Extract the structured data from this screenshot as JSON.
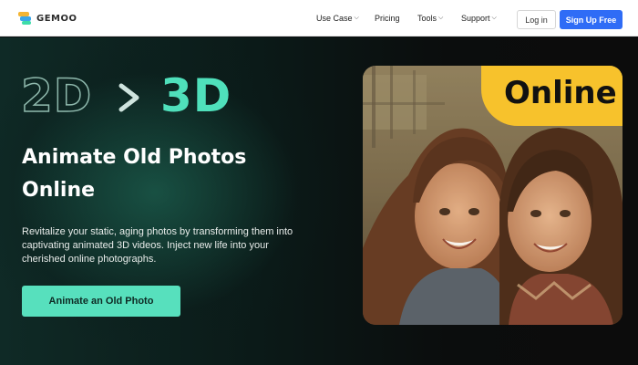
{
  "header": {
    "logo_text": "GEMOO",
    "nav": [
      {
        "label": "Use Case",
        "dropdown": true
      },
      {
        "label": "Pricing",
        "dropdown": false
      },
      {
        "label": "Tools",
        "dropdown": true
      },
      {
        "label": "Support",
        "dropdown": true
      }
    ],
    "login_label": "Log in",
    "signup_label": "Sign Up Free",
    "signup_color": "#2f6cf6"
  },
  "hero": {
    "from_label": "2D",
    "to_label": "3D",
    "title_line1": "Animate Old Photos",
    "title_line2": "Online",
    "description": "Revitalize your static, aging photos by transforming them into captivating animated 3D videos. Inject new life into your cherished online photographs.",
    "cta_label": "Animate an Old Photo",
    "accent_color": "#4fe0bb",
    "badge_text": "Online",
    "badge_color": "#f7c22c"
  }
}
